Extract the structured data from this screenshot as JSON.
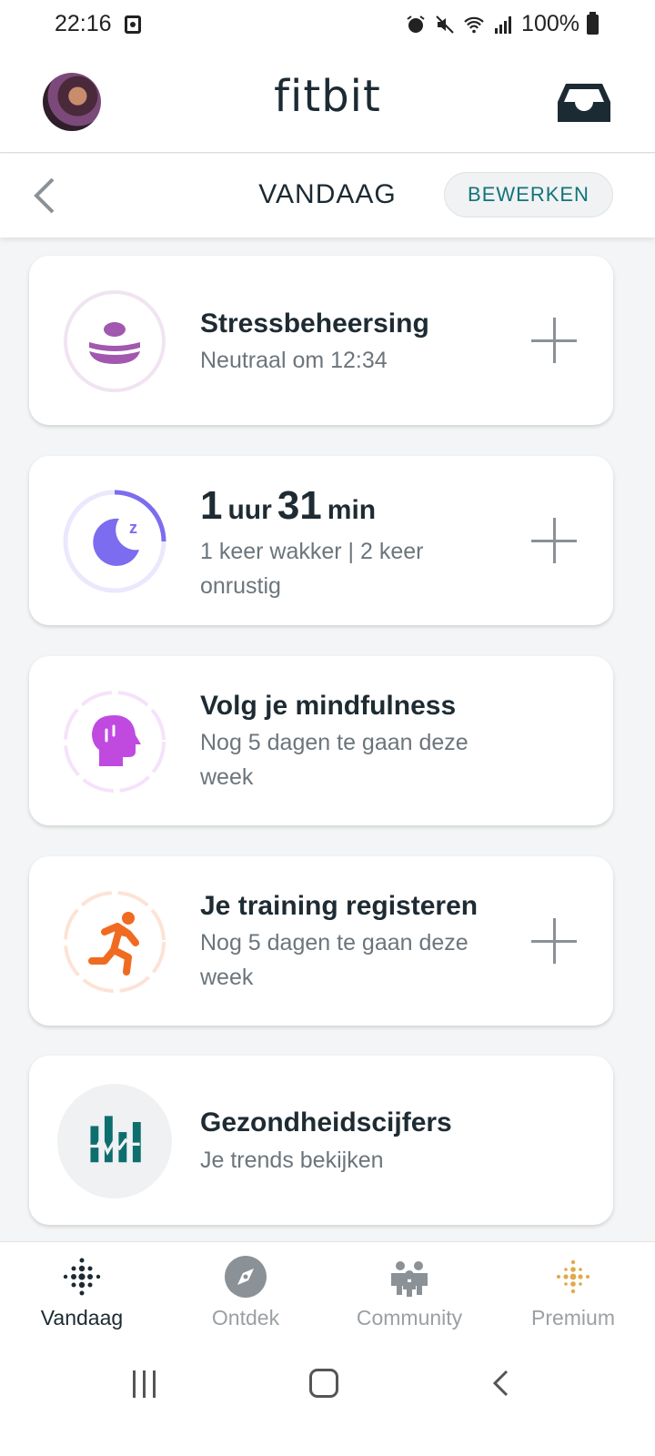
{
  "status": {
    "time": "22:16",
    "battery": "100%"
  },
  "header": {
    "logo": "fitbit"
  },
  "subheader": {
    "title": "VANDAAG",
    "edit_label": "BEWERKEN"
  },
  "cards": [
    {
      "title": "Stressbeheersing",
      "subtitle": "Neutraal om 12:34",
      "color": "#a258ae"
    },
    {
      "sleep_hours": "1",
      "hours_unit": "uur",
      "sleep_minutes": "31",
      "minutes_unit": "min",
      "subtitle": "1 keer wakker | 2 keer onrustig",
      "color": "#7b6cf0"
    },
    {
      "title": "Volg je mindfulness",
      "subtitle": "Nog 5 dagen te gaan deze week",
      "color": "#c04ae0"
    },
    {
      "title": "Je training registeren",
      "subtitle": "Nog 5 dagen te gaan deze week",
      "color": "#f06b22"
    },
    {
      "title": "Gezondheidscijfers",
      "subtitle": "Je trends bekijken",
      "color": "#0e6e6e"
    }
  ],
  "nav": [
    {
      "label": "Vandaag",
      "icon": "today-dots-icon",
      "active": true
    },
    {
      "label": "Ontdek",
      "icon": "compass-icon"
    },
    {
      "label": "Community",
      "icon": "community-icon"
    },
    {
      "label": "Premium",
      "icon": "premium-dots-icon"
    }
  ]
}
